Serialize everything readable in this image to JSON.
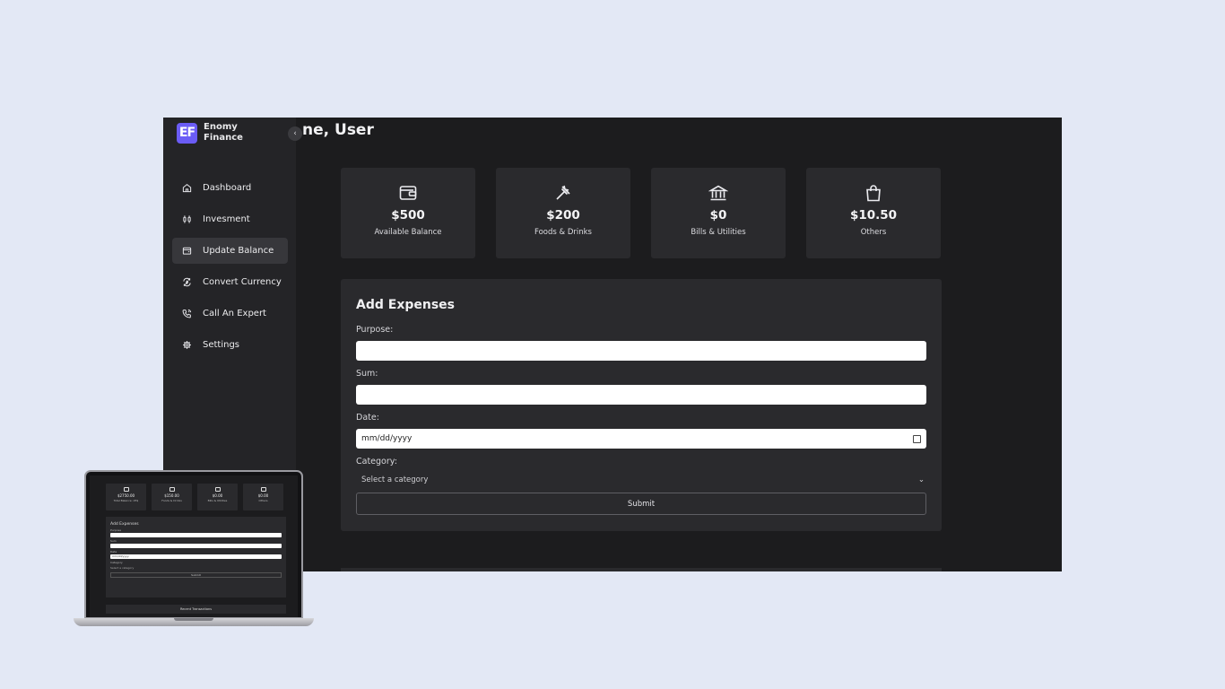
{
  "brand": {
    "logo": "EF",
    "name": "Enomy Finance"
  },
  "header": {
    "welcome_text": "ne, User"
  },
  "sidebar": {
    "collapse_icon": "chevron-left-icon",
    "items": [
      {
        "label": "Dashboard",
        "icon": "home-icon",
        "active": false
      },
      {
        "label": "Invesment",
        "icon": "investment-icon",
        "active": false
      },
      {
        "label": "Update Balance",
        "icon": "wallet-icon",
        "active": true
      },
      {
        "label": "Convert Currency",
        "icon": "currency-exchange-icon",
        "active": false
      },
      {
        "label": "Call An Expert",
        "icon": "phone-icon",
        "active": false
      },
      {
        "label": "Settings",
        "icon": "gear-icon",
        "active": false
      }
    ]
  },
  "cards": [
    {
      "value": "$500",
      "label": "Available Balance",
      "icon": "wallet-icon"
    },
    {
      "value": "$200",
      "label": "Foods & Drinks",
      "icon": "fork-icon"
    },
    {
      "value": "$0",
      "label": "Bills & Utilities",
      "icon": "bank-icon"
    },
    {
      "value": "$10.50",
      "label": "Others",
      "icon": "shopping-bag-icon"
    }
  ],
  "form": {
    "title": "Add Expenses",
    "purpose_label": "Purpose:",
    "purpose_value": "",
    "sum_label": "Sum:",
    "sum_value": "",
    "date_label": "Date:",
    "date_placeholder": "mm/dd/yyyy",
    "category_label": "Category:",
    "category_selected": "Select a category",
    "submit_label": "Submit"
  },
  "laptop_preview": {
    "cards": [
      {
        "value": "$2750.00",
        "label": "Total Balance: 25$"
      },
      {
        "value": "$150.00",
        "label": "Foods & Drinks"
      },
      {
        "value": "$0.00",
        "label": "Bills & Utilities"
      },
      {
        "value": "$0.00",
        "label": "Others"
      }
    ],
    "form_title": "Add Expenses",
    "labels": [
      "Purpose",
      "Sum",
      "Date",
      "Category"
    ],
    "date_placeholder": "mm/dd/yyyy",
    "category_selected": "Select a category",
    "submit_label": "Submit",
    "recent_title": "Recent Transactions"
  }
}
